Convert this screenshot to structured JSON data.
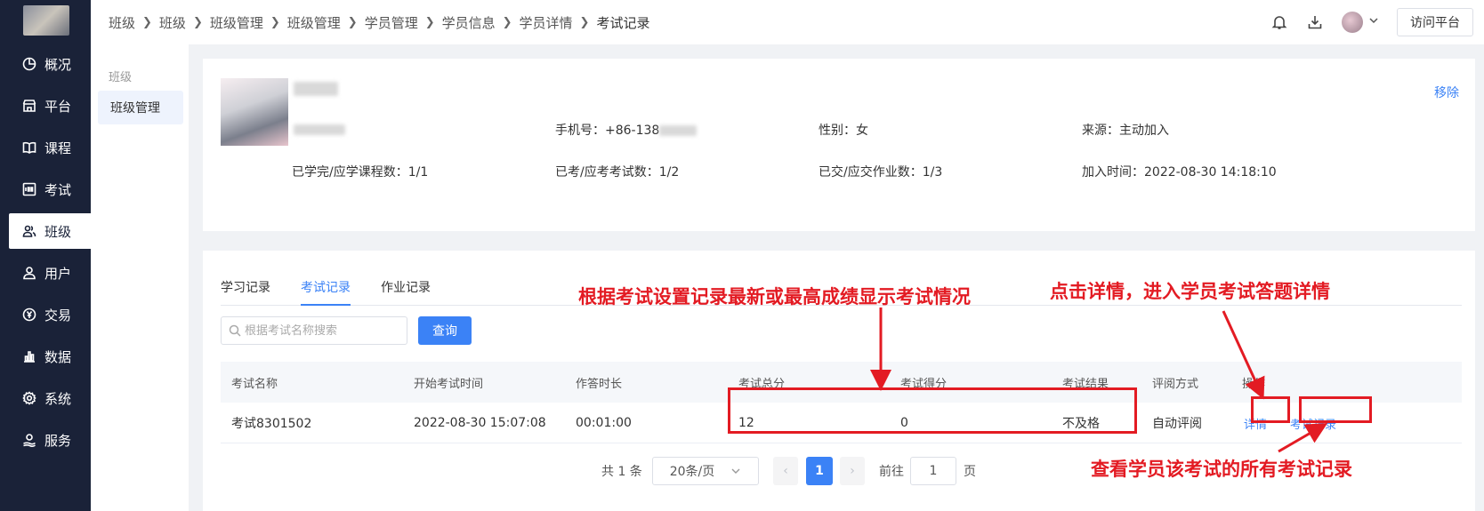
{
  "nav": {
    "items": [
      {
        "label": "概况",
        "icon": "pie-chart-icon"
      },
      {
        "label": "平台",
        "icon": "shop-icon"
      },
      {
        "label": "课程",
        "icon": "book-icon"
      },
      {
        "label": "考试",
        "icon": "exam-100-icon"
      },
      {
        "label": "班级",
        "icon": "users-icon",
        "active": true
      },
      {
        "label": "用户",
        "icon": "user-icon"
      },
      {
        "label": "交易",
        "icon": "yen-icon"
      },
      {
        "label": "数据",
        "icon": "bar-chart-icon"
      },
      {
        "label": "系统",
        "icon": "gear-icon"
      },
      {
        "label": "服务",
        "icon": "service-icon"
      }
    ]
  },
  "subnav": {
    "group": "班级",
    "item": "班级管理"
  },
  "breadcrumb": [
    "班级",
    "班级",
    "班级管理",
    "班级管理",
    "学员管理",
    "学员信息",
    "学员详情",
    "考试记录"
  ],
  "header": {
    "visit_label": "访问平台"
  },
  "student": {
    "phone": "手机号：+86-138",
    "gender": "性别：女",
    "source": "来源：主动加入",
    "courses": "已学完/应学课程数：1/1",
    "exams": "已考/应考考试数：1/2",
    "homework": "已交/应交作业数：1/3",
    "joined": "加入时间：2022-08-30 14:18:10",
    "remove_label": "移除"
  },
  "tabs": [
    {
      "label": "学习记录"
    },
    {
      "label": "考试记录",
      "active": true
    },
    {
      "label": "作业记录"
    }
  ],
  "search": {
    "placeholder": "根据考试名称搜索",
    "button": "查询"
  },
  "table": {
    "headers": [
      "考试名称",
      "开始考试时间",
      "作答时长",
      "考试总分",
      "考试得分",
      "考试结果",
      "评阅方式",
      "操作"
    ],
    "rows": [
      {
        "name": "考试8301502",
        "start": "2022-08-30 15:07:08",
        "duration": "00:01:00",
        "total": "12",
        "score": "0",
        "result": "不及格",
        "review": "自动评阅",
        "detail": "详情",
        "records": "考试记录"
      }
    ]
  },
  "pager": {
    "total": "共 1 条",
    "size": "20条/页",
    "current": "1",
    "goto_prefix": "前往",
    "goto_value": "1",
    "goto_suffix": "页"
  },
  "annotations": {
    "a1": "根据考试设置记录最新或最高成绩显示考试情况",
    "a2": "点击详情，进入学员考试答题详情",
    "a3": "查看学员该考试的所有考试记录"
  },
  "colors": {
    "accent": "#3b82f6",
    "sidebar": "#1a2238",
    "annotation": "#e31b23"
  }
}
